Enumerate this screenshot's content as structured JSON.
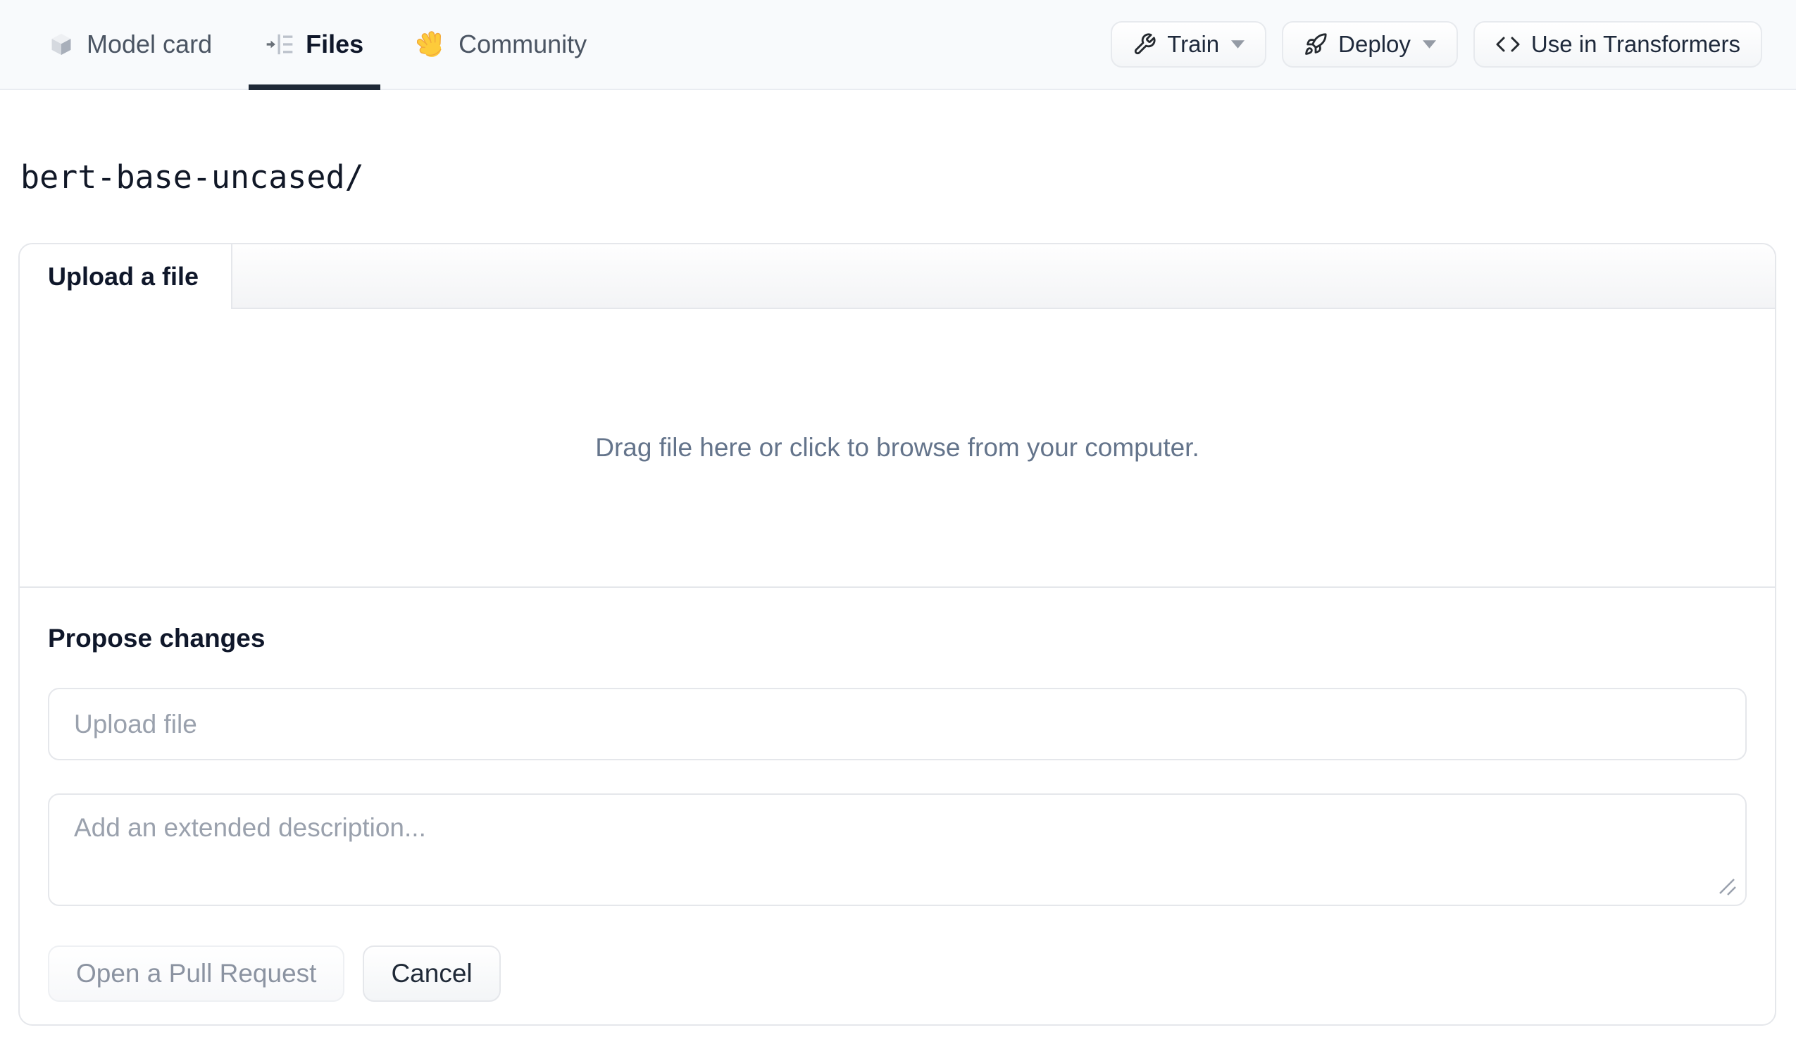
{
  "header": {
    "nav": [
      {
        "label": "Model card",
        "icon": "cube-icon",
        "active": false
      },
      {
        "label": "Files",
        "icon": "file-versions-icon",
        "active": true
      },
      {
        "label": "Community",
        "icon": "waving-hand-icon",
        "active": false
      }
    ],
    "buttons": {
      "train": "Train",
      "deploy": "Deploy",
      "use_in_transformers": "Use in Transformers"
    },
    "icons": {
      "train": "wrench-icon",
      "deploy": "rocket-icon",
      "use_in_transformers": "code-icon",
      "dropdown": "caret-down-icon"
    }
  },
  "repo": {
    "path": "bert-base-uncased/"
  },
  "upload_card": {
    "tab": "Upload a file",
    "dropzone_text": "Drag file here or click to browse from your computer.",
    "propose": {
      "heading": "Propose changes",
      "file_placeholder": "Upload file",
      "description_placeholder": "Add an extended description...",
      "open_pr_label": "Open a Pull Request",
      "cancel_label": "Cancel"
    }
  },
  "colors": {
    "header_bg": "#f8fafc",
    "active_tab_underline": "#1f2937",
    "border": "#e5e7eb",
    "muted_text": "#64748b",
    "placeholder": "#9aa1ad",
    "emoji_yellow": "#fdcb3a"
  }
}
